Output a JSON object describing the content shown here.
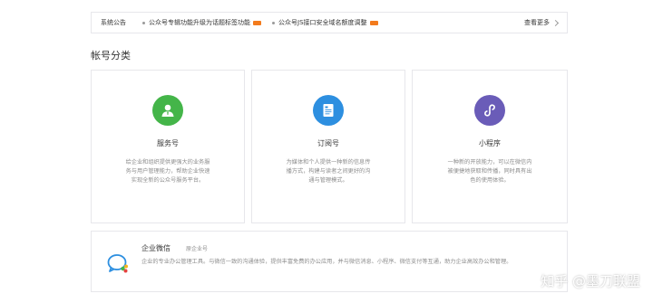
{
  "notice_bar": {
    "title": "系统公告",
    "items": [
      {
        "text": "公众号专辑功能升级为话题标签功能"
      },
      {
        "text": "公众号JS接口安全域名额度调整"
      }
    ],
    "more_label": "查看更多"
  },
  "section_title": "帐号分类",
  "cards": [
    {
      "name": "服务号",
      "desc": "给企业和组织提供更强大的业务服务与用户管理能力，帮助企业快速实现全新的公众号服务平台。",
      "icon": "user-card-icon",
      "color": "#44b549"
    },
    {
      "name": "订阅号",
      "desc": "为媒体和个人提供一种新的信息传播方式，构建与读者之间更好的沟通与管理模式。",
      "icon": "document-icon",
      "color": "#2d8fe0"
    },
    {
      "name": "小程序",
      "desc": "一种新的开放能力，可以在微信内被便捷地获取和传播，同时具有出色的使用体验。",
      "icon": "miniprogram-icon",
      "color": "#6a5cb8"
    }
  ],
  "wework": {
    "name": "企业微信",
    "tag": "原企业号",
    "desc": "企业的专业办公管理工具。与微信一致的沟通体验，提供丰富免费的办公应用，并与微信消息、小程序、微信支付等互通，助力企业高效办公和管理。",
    "icon": "wework-icon"
  },
  "watermark": "知乎 @墨刀联盟",
  "colors": {
    "border": "#e7e7eb",
    "badge": "#f37b1d"
  }
}
